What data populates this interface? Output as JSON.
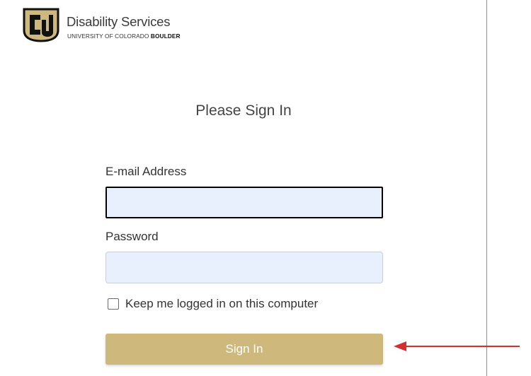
{
  "brand": {
    "name": "Disability Services",
    "sub_prefix": "UNIVERSITY OF COLORADO ",
    "sub_bold": "BOULDER"
  },
  "form": {
    "title": "Please Sign In",
    "email": {
      "label": "E-mail Address",
      "value": "",
      "placeholder": ""
    },
    "password": {
      "label": "Password",
      "value": "",
      "placeholder": ""
    },
    "remember": {
      "label": "Keep me logged in on this computer",
      "checked": false
    },
    "submit_label": "Sign In"
  },
  "colors": {
    "gold": "#cfb87c",
    "input_fill": "#e8f0fe",
    "arrow_red": "#d32f2f"
  },
  "icons": {
    "logo": "cu-logo-icon",
    "annotation": "arrow-left-icon"
  }
}
